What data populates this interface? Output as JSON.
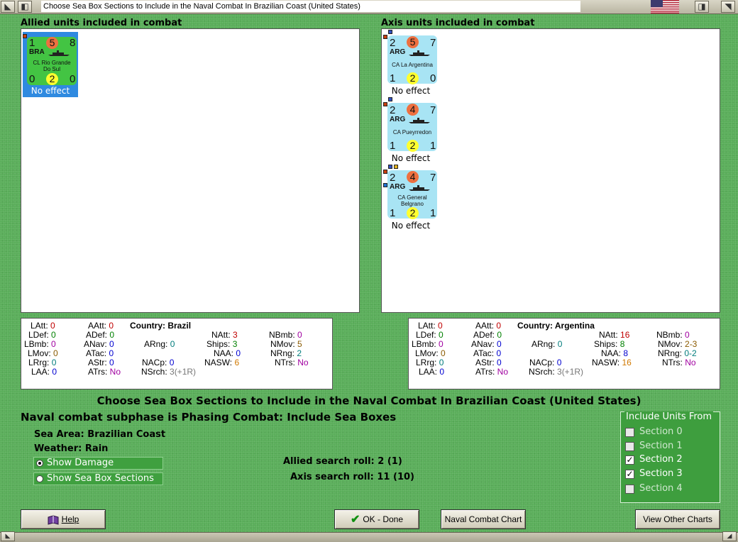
{
  "window": {
    "title": "Choose Sea Box Sections to Include in the Naval Combat In Brazilian Coast (United States)",
    "flag_icon": "us-flag-icon"
  },
  "allied_panel": {
    "label": "Allied units included in combat",
    "units": [
      {
        "att": "1",
        "circle_top": "5",
        "mov": "8",
        "nation": "BRA",
        "name": "CL Rio Grande Do Sul",
        "def": "0",
        "circle_bottom": "2",
        "rng": "0",
        "status": "No effect",
        "selected": true,
        "color": "#43c443"
      }
    ]
  },
  "axis_panel": {
    "label": "Axis units included in combat",
    "units": [
      {
        "att": "2",
        "circle_top": "5",
        "mov": "7",
        "nation": "ARG",
        "name": "CA La Argentina",
        "def": "1",
        "circle_bottom": "2",
        "rng": "0",
        "status": "No effect",
        "color": "#a8e4f4"
      },
      {
        "att": "2",
        "circle_top": "4",
        "mov": "7",
        "nation": "ARG",
        "name": "CA Pueyrredon",
        "def": "1",
        "circle_bottom": "2",
        "rng": "1",
        "status": "No effect",
        "color": "#a8e4f4"
      },
      {
        "att": "2",
        "circle_top": "4",
        "mov": "7",
        "nation": "ARG",
        "name": "CA General Belgrano",
        "def": "1",
        "circle_bottom": "2",
        "rng": "1",
        "status": "No effect",
        "color": "#a8e4f4"
      }
    ]
  },
  "allied_stats": {
    "country_label": "Country:",
    "country": "Brazil",
    "LAtt": "0",
    "LDef": "0",
    "LBmb": "0",
    "LMov": "0",
    "LRrg": "0",
    "LAA": "0",
    "AAtt": "0",
    "ADef": "0",
    "ANav": "0",
    "ATac": "0",
    "AStr": "0",
    "ATrs": "No",
    "ARng": "0",
    "NACp": "0",
    "NSrch": "3(+1R)",
    "NAtt": "3",
    "Ships": "3",
    "NAA": "0",
    "NASW": "6",
    "NBmb": "0",
    "NMov": "5",
    "NRng": "2",
    "NTrs": "No"
  },
  "axis_stats": {
    "country_label": "Country:",
    "country": "Argentina",
    "LAtt": "0",
    "LDef": "0",
    "LBmb": "0",
    "LMov": "0",
    "LRrg": "0",
    "LAA": "0",
    "AAtt": "0",
    "ADef": "0",
    "ANav": "0",
    "ATac": "0",
    "AStr": "0",
    "ATrs": "No",
    "ARng": "0",
    "NACp": "0",
    "NSrch": "3(+1R)",
    "NAtt": "16",
    "Ships": "8",
    "NAA": "8",
    "NASW": "16",
    "NBmb": "0",
    "NMov": "2-3",
    "NRng": "0-2",
    "NTrs": "No"
  },
  "main": {
    "heading": "Choose Sea Box Sections to Include in the Naval Combat In Brazilian Coast (United States)",
    "subphase": "Naval combat subphase is Phasing Combat: Include Sea Boxes",
    "sea_area_label": "Sea Area:",
    "sea_area": "Brazilian Coast",
    "weather_label": "Weather:",
    "weather": "Rain",
    "show_damage": "Show Damage",
    "show_sections": "Show Sea Box Sections",
    "allied_roll_label": "Allied search roll:",
    "allied_roll": "2 (1)",
    "axis_roll_label": "Axis search roll:",
    "axis_roll": "11 (10)"
  },
  "include_units": {
    "title": "Include Units From",
    "sections": [
      {
        "label": "Section 0",
        "checked": false
      },
      {
        "label": "Section 1",
        "checked": false
      },
      {
        "label": "Section 2",
        "checked": true
      },
      {
        "label": "Section 3",
        "checked": true
      },
      {
        "label": "Section 4",
        "checked": false
      }
    ]
  },
  "buttons": {
    "help": "Help",
    "ok": "OK - Done",
    "naval_chart": "Naval Combat Chart",
    "other_charts": "View Other Charts"
  }
}
